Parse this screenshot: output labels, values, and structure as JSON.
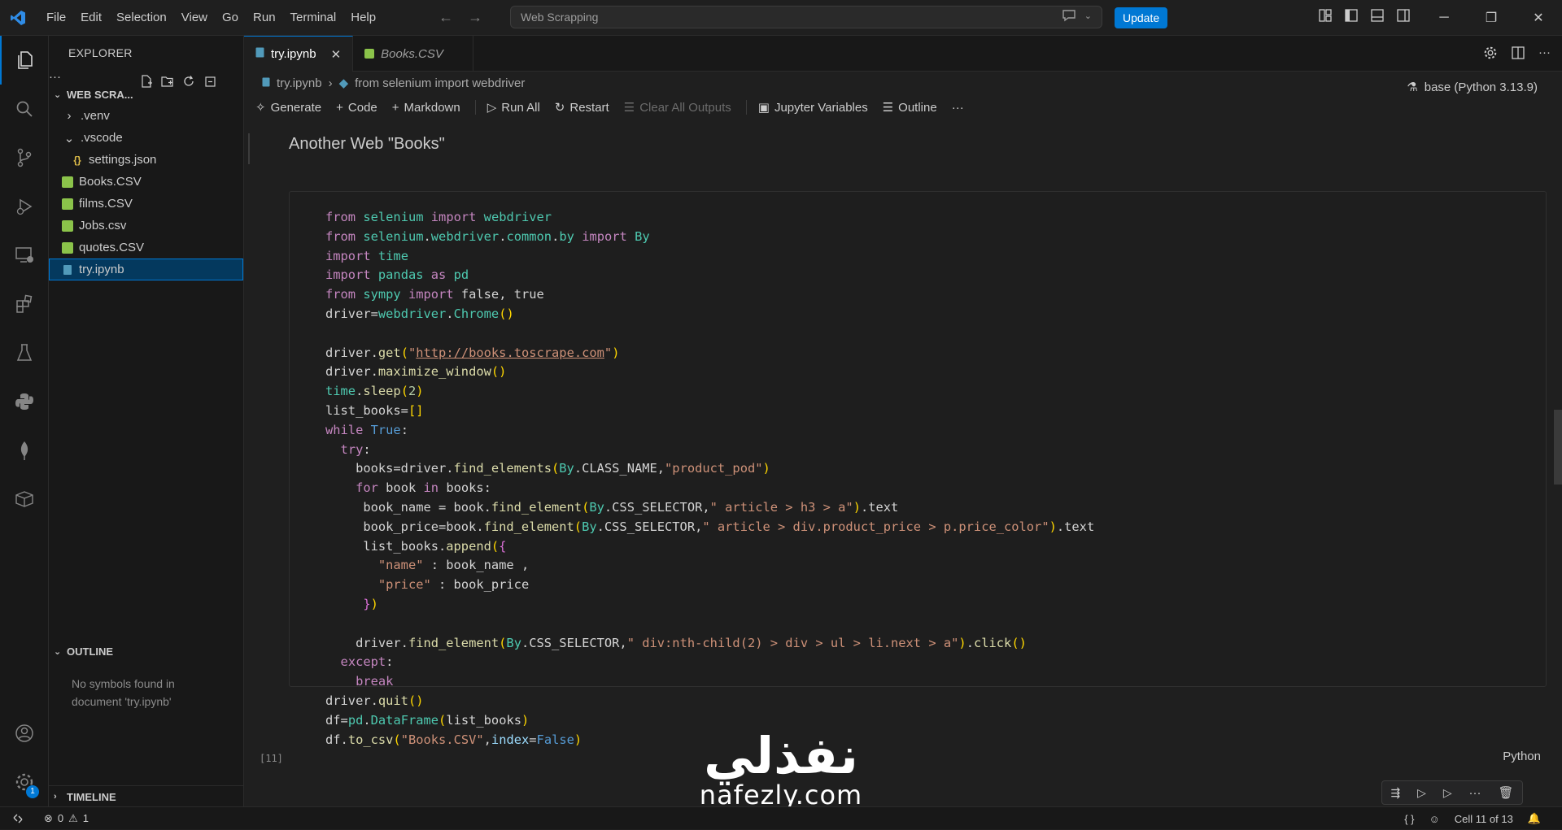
{
  "titlebar": {
    "menu": [
      "File",
      "Edit",
      "Selection",
      "View",
      "Go",
      "Run",
      "Terminal",
      "Help"
    ],
    "command_center": "Web Scrapping",
    "update_label": "Update"
  },
  "sidebar": {
    "header": "EXPLORER",
    "workspace": "WEB SCRA...",
    "items": [
      {
        "label": ".venv",
        "type": "folder-collapsed"
      },
      {
        "label": ".vscode",
        "type": "folder-expanded"
      },
      {
        "label": "settings.json",
        "type": "json"
      },
      {
        "label": "Books.CSV",
        "type": "csv"
      },
      {
        "label": "films.CSV",
        "type": "csv"
      },
      {
        "label": "Jobs.csv",
        "type": "csv"
      },
      {
        "label": "quotes.CSV",
        "type": "csv"
      },
      {
        "label": "try.ipynb",
        "type": "notebook",
        "selected": true
      }
    ],
    "outline_title": "OUTLINE",
    "outline_message": "No symbols found in document 'try.ipynb'",
    "timeline_title": "TIMELINE"
  },
  "activity_badge": "1",
  "tabs": [
    {
      "label": "try.ipynb",
      "active": true
    },
    {
      "label": "Books.CSV",
      "active": false,
      "italic": true
    }
  ],
  "breadcrumb": {
    "file": "try.ipynb",
    "symbol": "from selenium import webdriver"
  },
  "toolbar": {
    "generate": "Generate",
    "code": "Code",
    "markdown": "Markdown",
    "run_all": "Run All",
    "restart": "Restart",
    "clear_outputs": "Clear All Outputs",
    "variables": "Jupyter Variables",
    "outline": "Outline",
    "more": "···",
    "kernel": "base (Python 3.13.9)"
  },
  "notebook": {
    "markdown_title": "Another Web \"Books\"",
    "execution_count": "[11]",
    "language": "Python",
    "code_lines": [
      "from selenium import webdriver",
      "from selenium.webdriver.common.by import By",
      "import time",
      "import pandas as pd",
      "from sympy import false, true",
      "driver=webdriver.Chrome()",
      "",
      "driver.get(\"http://books.toscrape.com\")",
      "driver.maximize_window()",
      "time.sleep(2)",
      "list_books=[]",
      "while True:",
      "  try:",
      "    books=driver.find_elements(By.CLASS_NAME,\"product_pod\")",
      "    for book in books:",
      "     book_name = book.find_element(By.CSS_SELECTOR,\" article > h3 > a\").text",
      "     book_price=book.find_element(By.CSS_SELECTOR,\" article > div.product_price > p.price_color\").text",
      "     list_books.append({",
      "       \"name\" : book_name ,",
      "       \"price\" : book_price",
      "     })",
      "",
      "    driver.find_element(By.CSS_SELECTOR,\" div:nth-child(2) > div > ul > li.next > a\").click()",
      "  except:",
      "    break",
      "driver.quit()",
      "df=pd.DataFrame(list_books)",
      "df.to_csv(\"Books.CSV\",index=False)"
    ]
  },
  "watermark": {
    "arabic": "نفذلي",
    "latin": "nafezly.com"
  },
  "statusbar": {
    "errors": "0",
    "warnings": "1",
    "cell_position": "Cell 11 of 13"
  }
}
